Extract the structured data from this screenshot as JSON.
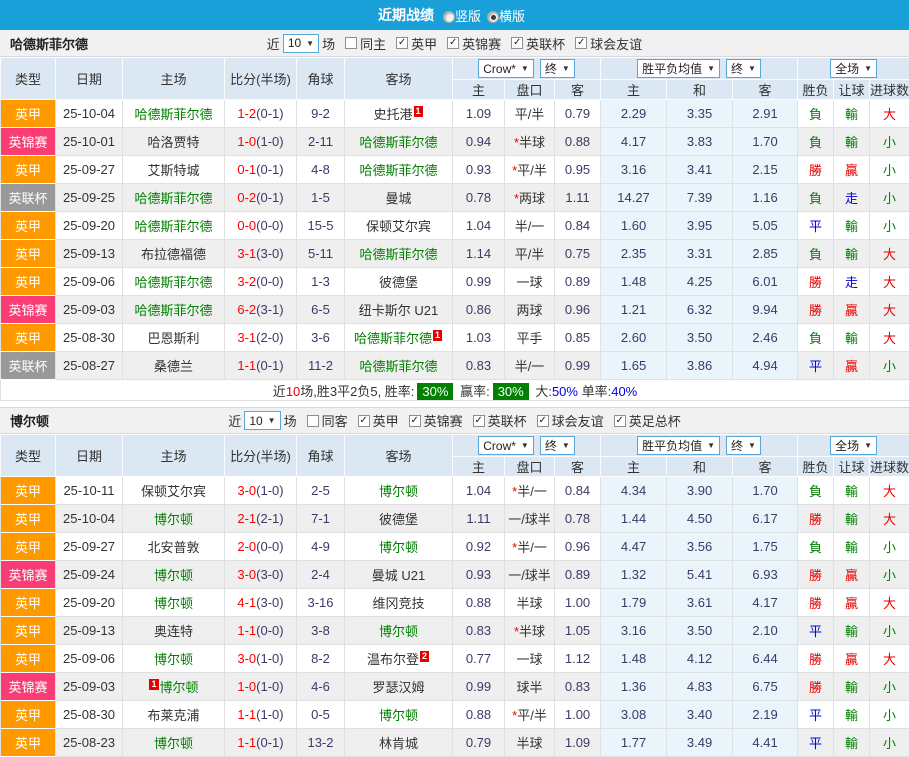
{
  "topbar": {
    "title": "近期战绩",
    "radios": [
      {
        "label": "竖版",
        "checked": false
      },
      {
        "label": "横版",
        "checked": true
      }
    ]
  },
  "icons": {
    "caret": "▼",
    "check": "✓"
  },
  "colors": {
    "bar": "#1aa0d8",
    "orange": "#ff9900",
    "pink": "#fa3c74",
    "grey": "#999999",
    "team_green": "#008000",
    "score_red": "#ff0000",
    "win_red": "#e60000",
    "lose_green": "#018001",
    "draw_blue": "#0000e0",
    "rate_badge": "#018001"
  },
  "header": {
    "left": [
      "类型",
      "日期",
      "主场",
      "比分(半场)",
      "角球",
      "客场"
    ],
    "subs": [
      "主",
      "盘口",
      "客",
      "主",
      "和",
      "客",
      "胜负",
      "让球",
      "进球数"
    ],
    "selects": [
      {
        "label": "Crow*"
      },
      {
        "label": "终"
      },
      {
        "label": "胜平负均值"
      },
      {
        "label": "终"
      },
      {
        "label": "全场"
      }
    ]
  },
  "sections": [
    {
      "team": "哈德斯菲尔德",
      "filter": {
        "near": "近",
        "count": "10",
        "games": "场",
        "same": "同主",
        "leagues": [
          "英甲",
          "英锦赛",
          "英联杯",
          "球会友谊"
        ]
      },
      "rows": [
        {
          "t": "英甲",
          "tc": "orange",
          "d": "25-10-04",
          "h": "哈德斯菲尔德",
          "hg": true,
          "s": "1-2",
          "sh": "(0-1)",
          "c": "9-2",
          "a": "史托港",
          "ag": false,
          "acard": "1",
          "o1": "1.09",
          "line": "平/半",
          "o2": "0.79",
          "m1": "2.29",
          "m2": "3.35",
          "m3": "2.91",
          "r": "負",
          "lv": "輸",
          "g": "大"
        },
        {
          "t": "英锦赛",
          "tc": "pink",
          "d": "25-10-01",
          "h": "哈洛贾特",
          "hg": false,
          "s": "1-0",
          "sh": "(1-0)",
          "c": "2-11",
          "a": "哈德斯菲尔德",
          "ag": true,
          "o1": "0.94",
          "line": "*半球",
          "o2": "0.88",
          "m1": "4.17",
          "m2": "3.83",
          "m3": "1.70",
          "r": "負",
          "lv": "輸",
          "g": "小"
        },
        {
          "t": "英甲",
          "tc": "orange",
          "d": "25-09-27",
          "h": "艾斯特城",
          "hg": false,
          "s": "0-1",
          "sh": "(0-1)",
          "c": "4-8",
          "a": "哈德斯菲尔德",
          "ag": true,
          "o1": "0.93",
          "line": "*平/半",
          "o2": "0.95",
          "m1": "3.16",
          "m2": "3.41",
          "m3": "2.15",
          "r": "勝",
          "lv": "贏",
          "g": "小"
        },
        {
          "t": "英联杯",
          "tc": "grey",
          "d": "25-09-25",
          "h": "哈德斯菲尔德",
          "hg": true,
          "s": "0-2",
          "sh": "(0-1)",
          "c": "1-5",
          "a": "曼城",
          "ag": false,
          "o1": "0.78",
          "line": "*两球",
          "o2": "1.11",
          "m1": "14.27",
          "m2": "7.39",
          "m3": "1.16",
          "r": "負",
          "lv": "走",
          "g": "小"
        },
        {
          "t": "英甲",
          "tc": "orange",
          "d": "25-09-20",
          "h": "哈德斯菲尔德",
          "hg": true,
          "s": "0-0",
          "sh": "(0-0)",
          "c": "15-5",
          "a": "保顿艾尔宾",
          "ag": false,
          "o1": "1.04",
          "line": "半/一",
          "o2": "0.84",
          "m1": "1.60",
          "m2": "3.95",
          "m3": "5.05",
          "r": "平",
          "lv": "輸",
          "g": "小"
        },
        {
          "t": "英甲",
          "tc": "orange",
          "d": "25-09-13",
          "h": "布拉德福德",
          "hg": false,
          "s": "3-1",
          "sh": "(3-0)",
          "c": "5-11",
          "a": "哈德斯菲尔德",
          "ag": true,
          "o1": "1.14",
          "line": "平/半",
          "o2": "0.75",
          "m1": "2.35",
          "m2": "3.31",
          "m3": "2.85",
          "r": "負",
          "lv": "輸",
          "g": "大"
        },
        {
          "t": "英甲",
          "tc": "orange",
          "d": "25-09-06",
          "h": "哈德斯菲尔德",
          "hg": true,
          "s": "3-2",
          "sh": "(0-0)",
          "c": "1-3",
          "a": "彼德堡",
          "ag": false,
          "o1": "0.99",
          "line": "一球",
          "o2": "0.89",
          "m1": "1.48",
          "m2": "4.25",
          "m3": "6.01",
          "r": "勝",
          "lv": "走",
          "g": "大"
        },
        {
          "t": "英锦赛",
          "tc": "pink",
          "d": "25-09-03",
          "h": "哈德斯菲尔德",
          "hg": true,
          "s": "6-2",
          "sh": "(3-1)",
          "c": "6-5",
          "a": "纽卡斯尔 U21",
          "ag": false,
          "o1": "0.86",
          "line": "两球",
          "o2": "0.96",
          "m1": "1.21",
          "m2": "6.32",
          "m3": "9.94",
          "r": "勝",
          "lv": "贏",
          "g": "大"
        },
        {
          "t": "英甲",
          "tc": "orange",
          "d": "25-08-30",
          "h": "巴恩斯利",
          "hg": false,
          "s": "3-1",
          "sh": "(2-0)",
          "c": "3-6",
          "a": "哈德斯菲尔德",
          "ag": true,
          "acard": "1",
          "o1": "1.03",
          "line": "平手",
          "o2": "0.85",
          "m1": "2.60",
          "m2": "3.50",
          "m3": "2.46",
          "r": "負",
          "lv": "輸",
          "g": "大"
        },
        {
          "t": "英联杯",
          "tc": "grey",
          "d": "25-08-27",
          "h": "桑德兰",
          "hg": false,
          "s": "1-1",
          "sh": "(0-1)",
          "c": "11-2",
          "a": "哈德斯菲尔德",
          "ag": true,
          "o1": "0.83",
          "line": "半/一",
          "o2": "0.99",
          "m1": "1.65",
          "m2": "3.86",
          "m3": "4.94",
          "r": "平",
          "lv": "贏",
          "g": "小"
        }
      ],
      "summary": {
        "parts": [
          {
            "t": "近"
          },
          {
            "t": "10",
            "s": "red"
          },
          {
            "t": "场,胜3平2负5, 胜率:"
          },
          {
            "t": "30%",
            "s": "badge"
          },
          {
            "t": " 赢率:"
          },
          {
            "t": "30%",
            "s": "badge"
          },
          {
            "t": " 大:"
          },
          {
            "t": "50%",
            "s": "blue"
          },
          {
            "t": " 单率:"
          },
          {
            "t": "40%",
            "s": "blue"
          }
        ]
      }
    },
    {
      "team": "博尔顿",
      "filter": {
        "near": "近",
        "count": "10",
        "games": "场",
        "same": "同客",
        "leagues": [
          "英甲",
          "英锦赛",
          "英联杯",
          "球会友谊",
          "英足总杯"
        ]
      },
      "rows": [
        {
          "t": "英甲",
          "tc": "orange",
          "d": "25-10-11",
          "h": "保顿艾尔宾",
          "hg": false,
          "s": "3-0",
          "sh": "(1-0)",
          "c": "2-5",
          "a": "博尔顿",
          "ag": true,
          "o1": "1.04",
          "line": "*半/一",
          "o2": "0.84",
          "m1": "4.34",
          "m2": "3.90",
          "m3": "1.70",
          "r": "負",
          "lv": "輸",
          "g": "大"
        },
        {
          "t": "英甲",
          "tc": "orange",
          "d": "25-10-04",
          "h": "博尔顿",
          "hg": true,
          "s": "2-1",
          "sh": "(2-1)",
          "c": "7-1",
          "a": "彼德堡",
          "ag": false,
          "o1": "1.11",
          "line": "一/球半",
          "o2": "0.78",
          "m1": "1.44",
          "m2": "4.50",
          "m3": "6.17",
          "r": "勝",
          "lv": "輸",
          "g": "大"
        },
        {
          "t": "英甲",
          "tc": "orange",
          "d": "25-09-27",
          "h": "北安普敦",
          "hg": false,
          "s": "2-0",
          "sh": "(0-0)",
          "c": "4-9",
          "a": "博尔顿",
          "ag": true,
          "o1": "0.92",
          "line": "*半/一",
          "o2": "0.96",
          "m1": "4.47",
          "m2": "3.56",
          "m3": "1.75",
          "r": "負",
          "lv": "輸",
          "g": "小"
        },
        {
          "t": "英锦赛",
          "tc": "pink",
          "d": "25-09-24",
          "h": "博尔顿",
          "hg": true,
          "s": "3-0",
          "sh": "(3-0)",
          "c": "2-4",
          "a": "曼城 U21",
          "ag": false,
          "o1": "0.93",
          "line": "一/球半",
          "o2": "0.89",
          "m1": "1.32",
          "m2": "5.41",
          "m3": "6.93",
          "r": "勝",
          "lv": "贏",
          "g": "小"
        },
        {
          "t": "英甲",
          "tc": "orange",
          "d": "25-09-20",
          "h": "博尔顿",
          "hg": true,
          "s": "4-1",
          "sh": "(3-0)",
          "c": "3-16",
          "a": "维冈竞技",
          "ag": false,
          "o1": "0.88",
          "line": "半球",
          "o2": "1.00",
          "m1": "1.79",
          "m2": "3.61",
          "m3": "4.17",
          "r": "勝",
          "lv": "贏",
          "g": "大"
        },
        {
          "t": "英甲",
          "tc": "orange",
          "d": "25-09-13",
          "h": "奥连特",
          "hg": false,
          "s": "1-1",
          "sh": "(0-0)",
          "c": "3-8",
          "a": "博尔顿",
          "ag": true,
          "o1": "0.83",
          "line": "*半球",
          "o2": "1.05",
          "m1": "3.16",
          "m2": "3.50",
          "m3": "2.10",
          "r": "平",
          "lv": "輸",
          "g": "小"
        },
        {
          "t": "英甲",
          "tc": "orange",
          "d": "25-09-06",
          "h": "博尔顿",
          "hg": true,
          "s": "3-0",
          "sh": "(1-0)",
          "c": "8-2",
          "a": "温布尔登",
          "ag": false,
          "acard": "2",
          "o1": "0.77",
          "line": "一球",
          "o2": "1.12",
          "m1": "1.48",
          "m2": "4.12",
          "m3": "6.44",
          "r": "勝",
          "lv": "贏",
          "g": "大"
        },
        {
          "t": "英锦赛",
          "tc": "pink",
          "d": "25-09-03",
          "h": "博尔顿",
          "hg": true,
          "hpre": "1",
          "s": "1-0",
          "sh": "(1-0)",
          "c": "4-6",
          "a": "罗瑟汉姆",
          "ag": false,
          "o1": "0.99",
          "line": "球半",
          "o2": "0.83",
          "m1": "1.36",
          "m2": "4.83",
          "m3": "6.75",
          "r": "勝",
          "lv": "輸",
          "g": "小"
        },
        {
          "t": "英甲",
          "tc": "orange",
          "d": "25-08-30",
          "h": "布莱克浦",
          "hg": false,
          "s": "1-1",
          "sh": "(1-0)",
          "c": "0-5",
          "a": "博尔顿",
          "ag": true,
          "o1": "0.88",
          "line": "*平/半",
          "o2": "1.00",
          "m1": "3.08",
          "m2": "3.40",
          "m3": "2.19",
          "r": "平",
          "lv": "輸",
          "g": "小"
        },
        {
          "t": "英甲",
          "tc": "orange",
          "d": "25-08-23",
          "h": "博尔顿",
          "hg": true,
          "s": "1-1",
          "sh": "(0-1)",
          "c": "13-2",
          "a": "林肯城",
          "ag": false,
          "o1": "0.79",
          "line": "半球",
          "o2": "1.09",
          "m1": "1.77",
          "m2": "3.49",
          "m3": "4.41",
          "r": "平",
          "lv": "輸",
          "g": "小"
        }
      ]
    }
  ]
}
